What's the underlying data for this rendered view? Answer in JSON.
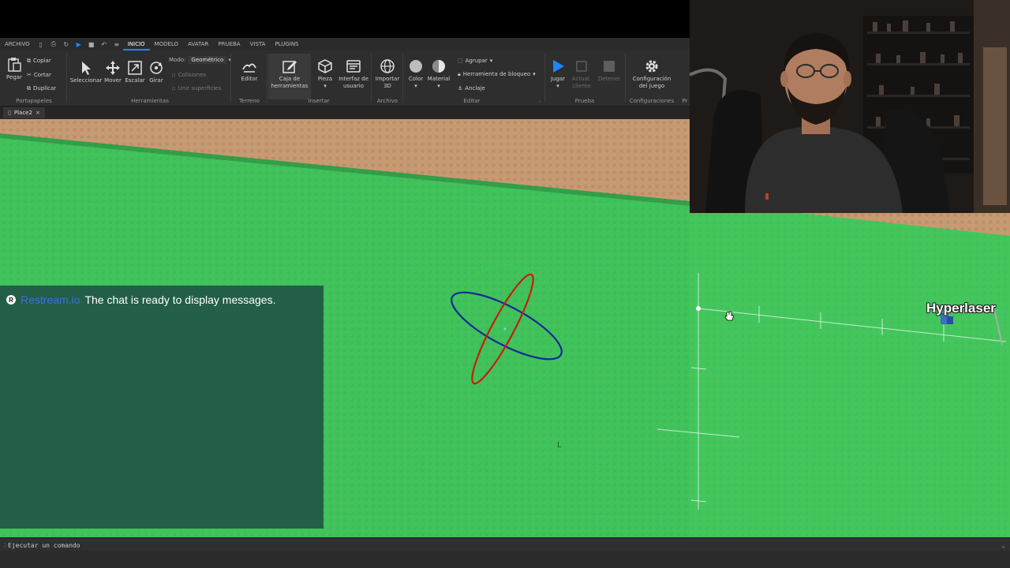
{
  "menubar": {
    "file": "ARCHIVO",
    "tabs": [
      "INICIO",
      "MODELO",
      "AVATAR",
      "PRUEBA",
      "VISTA",
      "PLUGINS"
    ],
    "active_tab": "INICIO"
  },
  "ribbon": {
    "paste": "Pegar",
    "copy": "Copiar",
    "cut": "Cortar",
    "duplicate": "Duplicar",
    "clipboard_group": "Portapapeles",
    "select": "Seleccionar",
    "move": "Mover",
    "scale": "Escalar",
    "rotate": "Girar",
    "mode_label": "Modo:",
    "mode_value": "Geométrico",
    "collisions": "Colisiones",
    "join_surfaces": "Unir superficies",
    "tools_group": "Herramientas",
    "editor": "Editor",
    "terrain_group": "Terreno",
    "toolbox_line1": "Caja de",
    "toolbox_line2": "herramientas",
    "part": "Pieza",
    "ui_line1": "Interfaz de",
    "ui_line2": "usuario",
    "insert_group": "Insertar",
    "import_line1": "Importar",
    "import_line2": "3D",
    "file_group": "Archivo",
    "color": "Color",
    "material": "Material",
    "group": "Agrupar",
    "block_tool": "Herramienta de bloqueo",
    "anchor": "Anclaje",
    "edit_group": "Editar",
    "play": "Jugar",
    "update_line1": "Actual.",
    "update_line2": "cliente",
    "stop": "Detener",
    "test_group": "Prueba",
    "game_settings_line1": "Configuración",
    "game_settings_line2": "del juego",
    "settings_group": "Configuraciones",
    "cut_group": "Pr"
  },
  "tabs": {
    "place": "Place2",
    "close": "×"
  },
  "chat": {
    "service": "Restream.io",
    "message": "The chat is ready to display messages."
  },
  "viewport": {
    "player_name": "Hyperlaser"
  },
  "command": {
    "placeholder": "Ejecutar un comando"
  },
  "colors": {
    "accent": "#1f86ff",
    "baseplate": "#3fc35a",
    "ground": "#c79a72",
    "chat_bg": "#205046",
    "rotate_ring_red": "#c81e0a",
    "rotate_ring_blue": "#142896",
    "rotate_ring_green": "#3cdc3c"
  }
}
